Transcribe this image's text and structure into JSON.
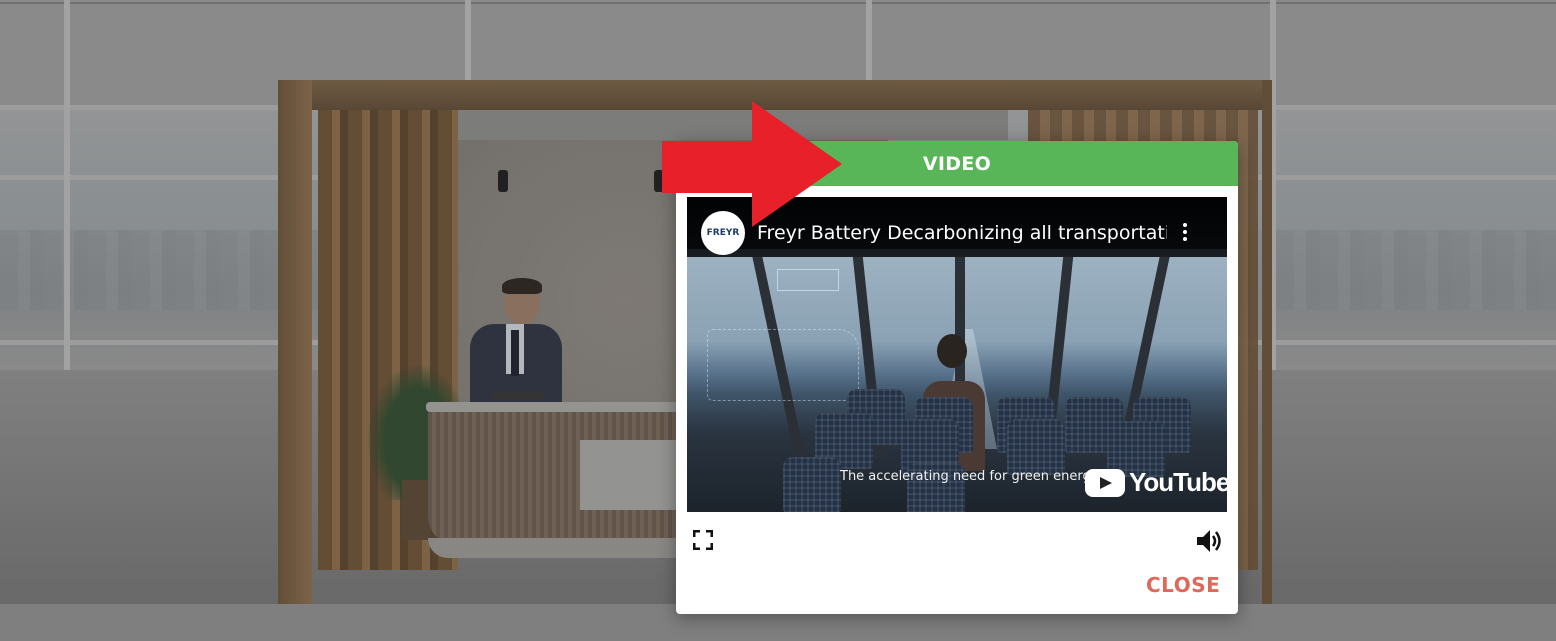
{
  "modal": {
    "title": "VIDEO",
    "close_label": "CLOSE"
  },
  "video": {
    "channel_logo_text": "FREYR",
    "title": "Freyr Battery Decarbonizing all transportati...",
    "caption": "The accelerating need for green energ",
    "platform_label": "YouTube"
  },
  "colors": {
    "header_green": "#58b558",
    "close_red": "#e0685b",
    "arrow_red": "#e8202a"
  },
  "icons": {
    "fullscreen": "fullscreen-icon",
    "volume": "volume-icon",
    "more": "more-options-icon",
    "arrow": "red-arrow-icon"
  }
}
